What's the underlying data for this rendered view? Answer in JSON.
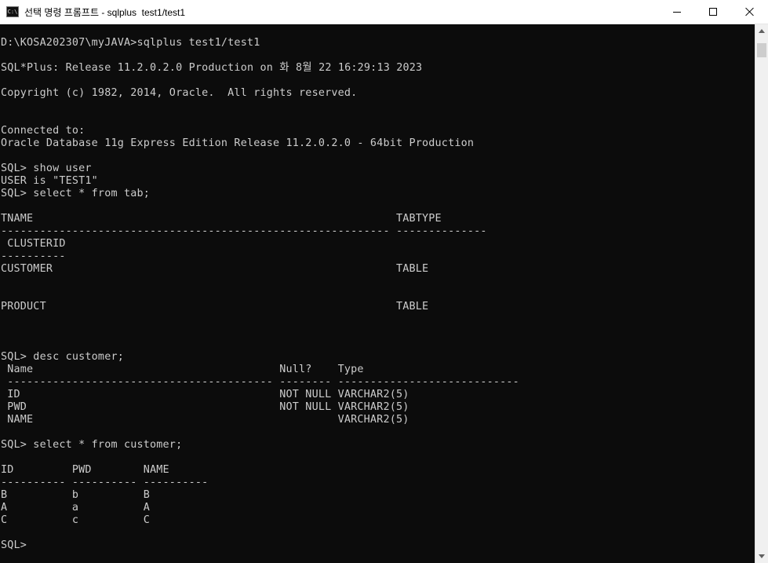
{
  "window": {
    "title": "선택 명령 프롬프트 - sqlplus  test1/test1",
    "icon_text": "C:\\",
    "icons": {
      "app": "command-prompt-icon",
      "minimize": "minimize-icon",
      "maximize": "maximize-icon",
      "close": "close-icon"
    }
  },
  "colors": {
    "console_background": "#0c0c0c",
    "console_text": "#cccccc",
    "titlebar_background": "#ffffff"
  },
  "console": {
    "lines": [
      "D:\\KOSA202307\\myJAVA>sqlplus test1/test1",
      "",
      "SQL*Plus: Release 11.2.0.2.0 Production on 화 8월 22 16:29:13 2023",
      "",
      "Copyright (c) 1982, 2014, Oracle.  All rights reserved.",
      "",
      "",
      "Connected to:",
      "Oracle Database 11g Express Edition Release 11.2.0.2.0 - 64bit Production",
      "",
      "SQL> show user",
      "USER is \"TEST1\"",
      "SQL> select * from tab;",
      "",
      "TNAME                                                        TABTYPE",
      "------------------------------------------------------------ --------------",
      " CLUSTERID",
      "----------",
      "CUSTOMER                                                     TABLE",
      "",
      "",
      "PRODUCT                                                      TABLE",
      "",
      "",
      "",
      "SQL> desc customer;",
      " Name                                      Null?    Type",
      " ----------------------------------------- -------- ----------------------------",
      " ID                                        NOT NULL VARCHAR2(5)",
      " PWD                                       NOT NULL VARCHAR2(5)",
      " NAME                                               VARCHAR2(5)",
      "",
      "SQL> select * from customer;",
      "",
      "ID         PWD        NAME",
      "---------- ---------- ----------",
      "B          b          B",
      "A          a          A",
      "C          c          C",
      "",
      "SQL>"
    ]
  }
}
